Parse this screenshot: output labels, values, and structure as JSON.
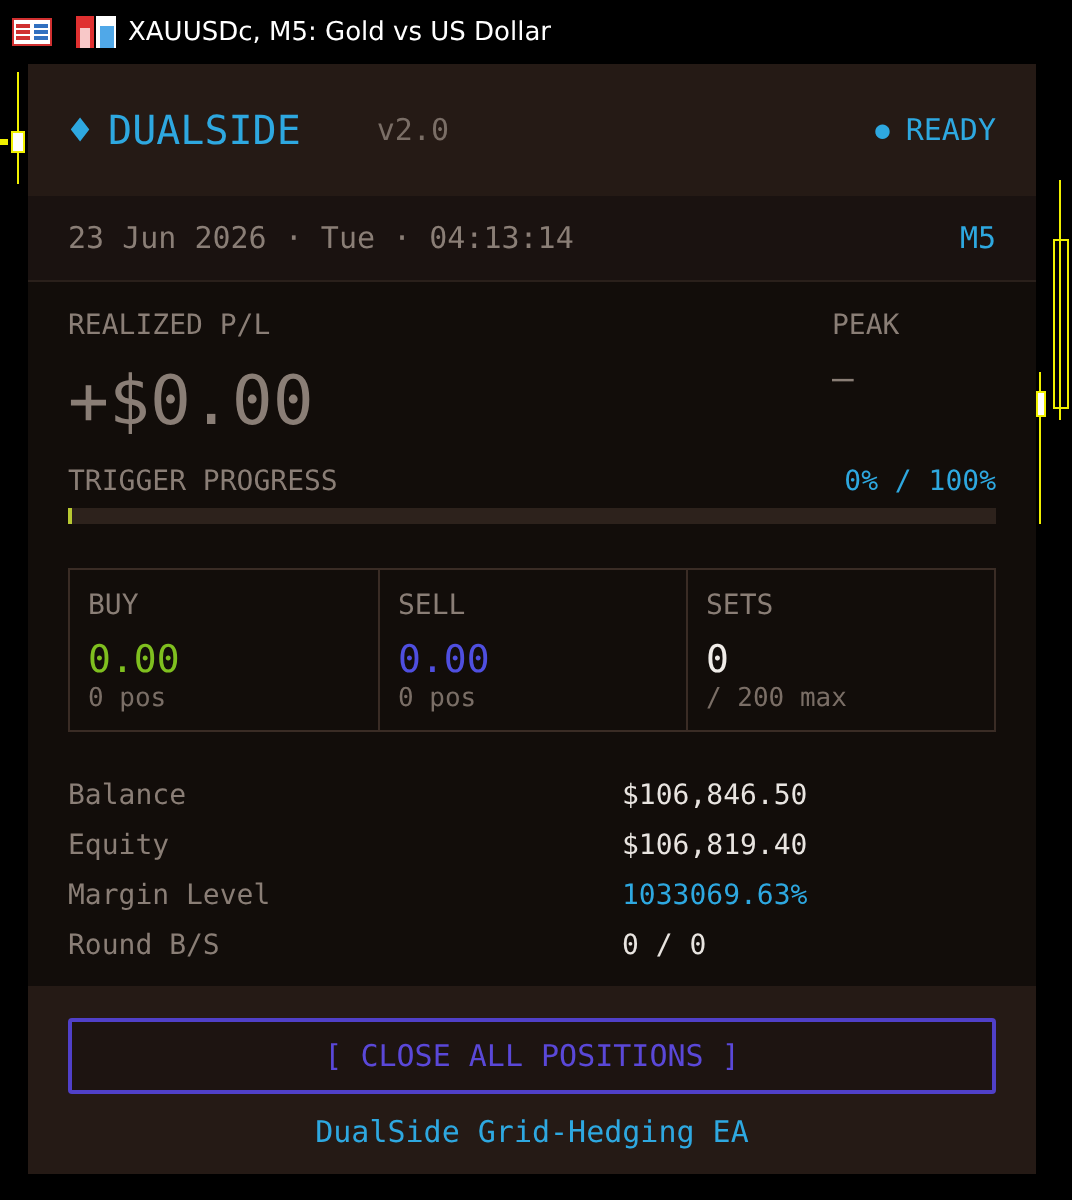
{
  "chart_window": {
    "title": "XAUUSDc, M5:  Gold vs US Dollar"
  },
  "header": {
    "diamond": "♦",
    "title": "DUALSIDE",
    "version": "v2.0",
    "status_dot": "●",
    "status": "READY"
  },
  "date_row": {
    "datetime": "23 Jun 2026 · Tue · 04:13:14",
    "timeframe": "M5"
  },
  "pnl": {
    "label": "REALIZED P/L",
    "value": "+$0.00",
    "peak_label": "PEAK",
    "peak_value": "—"
  },
  "trigger": {
    "label": "TRIGGER PROGRESS",
    "reading": "0% / 100%",
    "level": 0
  },
  "stats": [
    {
      "label": "BUY",
      "value": "0.00",
      "sub": "0 pos",
      "color": "#7fbf1f"
    },
    {
      "label": "SELL",
      "value": "0.00",
      "sub": "0 pos",
      "color": "#4f4fe0"
    },
    {
      "label": "SETS",
      "value": "0",
      "sub": "/ 200 max",
      "color": "#f0ece8"
    }
  ],
  "info": [
    {
      "label": "Balance",
      "value": "$106,846.50",
      "color": "#e8e4e0"
    },
    {
      "label": "Equity",
      "value": "$106,819.40",
      "color": "#e8e4e0"
    },
    {
      "label": "Margin Level",
      "value": "1033069.63%",
      "color": "#2ea8e0"
    },
    {
      "label": "Round B/S",
      "value": "0 / 0",
      "color": "#e8e4e0"
    }
  ],
  "button": {
    "label": "[ CLOSE ALL POSITIONS ]"
  },
  "footer": {
    "text": "DualSide Grid-Hedging EA"
  }
}
